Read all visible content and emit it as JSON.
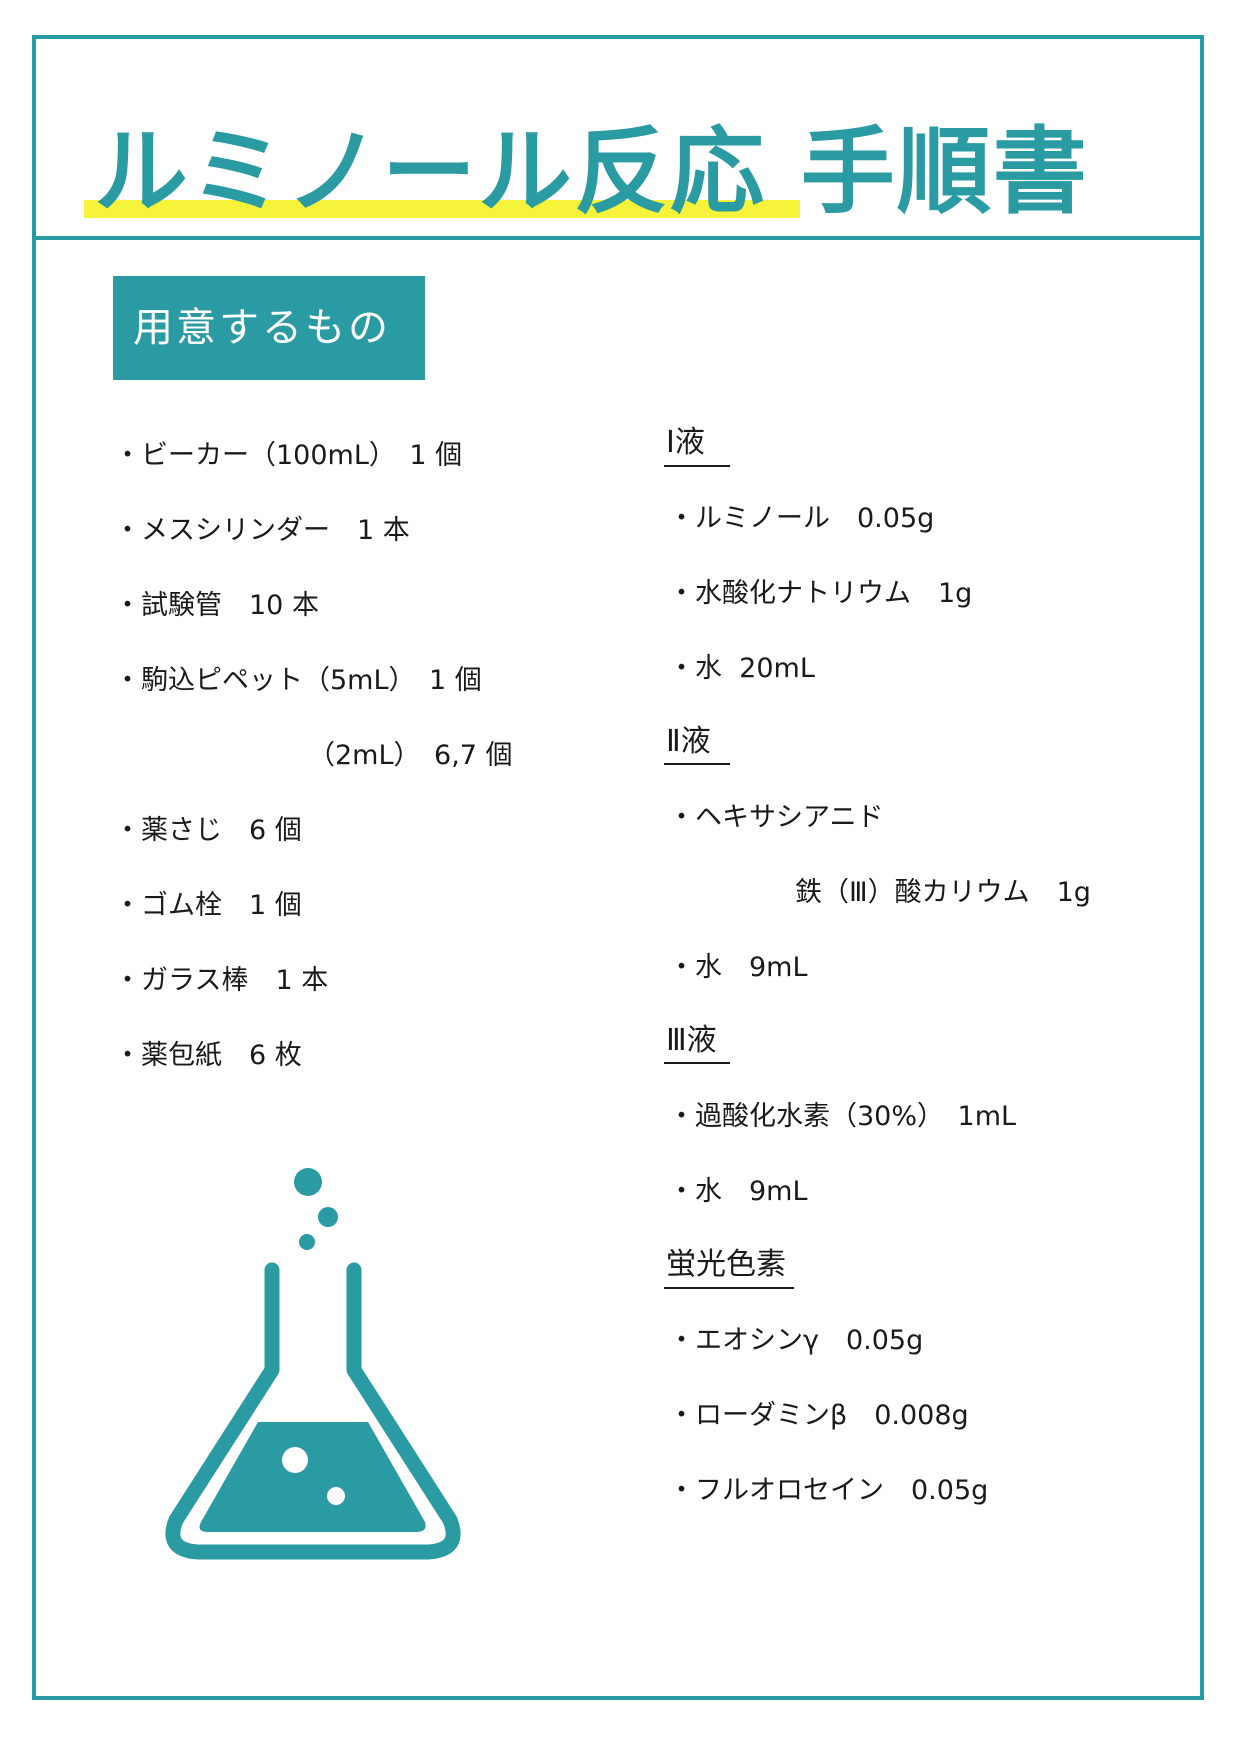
{
  "title": "ルミノール反応 手順書",
  "section_label": "用意するもの",
  "materials": [
    "・ビーカー（100mL）　1 個",
    "・メスシリンダー　1 本",
    "・試験管　10 本",
    "・駒込ピペット（5mL）　1 個",
    "（2mL）　6,7 個",
    "・薬さじ　6 個",
    "・ゴム栓　1 個",
    "・ガラス棒　1 本",
    "・薬包紙　6 枚"
  ],
  "solution1": {
    "heading": "Ⅰ液",
    "items": [
      "・ルミノール　0.05g",
      "・水酸化ナトリウム　1g",
      "・水  20mL"
    ]
  },
  "solution2": {
    "heading": "Ⅱ液",
    "items": [
      "・ヘキサシアニド",
      "鉄（Ⅲ）酸カリウム　1g",
      "・水　9mL"
    ]
  },
  "solution3": {
    "heading": "Ⅲ液",
    "items": [
      "・過酸化水素（30%）　1mL",
      "・水　9mL"
    ]
  },
  "dyes": {
    "heading": "蛍光色素",
    "items": [
      "・エオシンγ　0.05g",
      "・ローダミンβ　0.008g",
      "・フルオロセイン　0.05g"
    ]
  },
  "colors": {
    "accent": "#2a9aa3",
    "highlight": "#f6f33a",
    "text": "#1a1a1a"
  },
  "icons": {
    "flask": "flask-icon"
  }
}
